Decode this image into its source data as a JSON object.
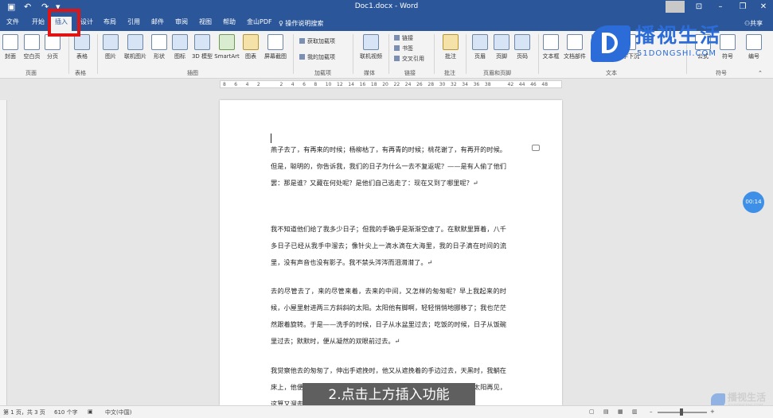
{
  "titlebar": {
    "doc_title": "Doc1.docx  -  Word",
    "save_icon": "save-icon",
    "undo_icon": "undo-icon",
    "redo_icon": "redo-icon"
  },
  "tabs": [
    {
      "label": "文件",
      "active": false
    },
    {
      "label": "开始",
      "active": false
    },
    {
      "label": "插入",
      "active": true
    },
    {
      "label": "设计",
      "active": false
    },
    {
      "label": "布局",
      "active": false
    },
    {
      "label": "引用",
      "active": false
    },
    {
      "label": "邮件",
      "active": false
    },
    {
      "label": "审阅",
      "active": false
    },
    {
      "label": "视图",
      "active": false
    },
    {
      "label": "帮助",
      "active": false
    },
    {
      "label": "金山PDF",
      "active": false
    }
  ],
  "tell_me": "操作说明搜索",
  "share": "共享",
  "ribbon": {
    "buttons": [
      "封面",
      "空白页",
      "分页",
      "表格",
      "图片",
      "联机图片",
      "形状",
      "图标",
      "3D 模型",
      "SmartArt",
      "图表",
      "屏幕截图",
      "联机视频",
      "批注",
      "页眉",
      "页脚",
      "页码",
      "文本框",
      "文档部件",
      "艺术字",
      "首字下沉",
      "公式",
      "符号",
      "编号"
    ],
    "small": [
      "获取加载项",
      "我的加载项",
      "链接",
      "书签",
      "交叉引用"
    ],
    "groups": [
      "页面",
      "表格",
      "插图",
      "加载项",
      "媒体",
      "链接",
      "批注",
      "页眉和页脚",
      "文本",
      "符号"
    ]
  },
  "logo": {
    "name": "播视生活",
    "url": "51DONGSHI.COM"
  },
  "ruler_ticks": [
    "8",
    "6",
    "4",
    "2",
    "",
    "2",
    "4",
    "6",
    "8",
    "10",
    "12",
    "14",
    "16",
    "18",
    "20",
    "22",
    "24",
    "26",
    "28",
    "30",
    "32",
    "34",
    "36",
    "38",
    "",
    "42",
    "44",
    "46",
    "48"
  ],
  "document": {
    "paragraphs": [
      "燕子去了，有再来的时候；杨柳枯了，有再青的时候；桃花谢了，有再开的时候。但是，聪明的，你告诉我，我们的日子为什么一去不复返呢？——是有人偷了他们罢：那是谁？又藏在何处呢？是他们自己逃走了：现在又到了哪里呢？↵",
      "我不知道他们给了我多少日子；但我的手确乎是渐渐空虚了。在默默里算着，八千多日子已经从我手中溜去；像针尖上一滴水滴在大海里，我的日子滴在时间的流里，没有声音也没有影子。我不禁头涔涔而泪潸潸了。↵",
      "去的尽管去了，来的尽管来着，去来的中间，又怎样的匆匆呢？早上我起来的时候，小屋里射进两三方斜斜的太阳。太阳他有脚啊，轻轻悄悄地挪移了；我也茫茫然跟着旋转。于是——洗手的时候，日子从水盆里过去；吃饭的时候，日子从饭碗里过去；默默时，便从凝然的双眼前过去。↵",
      "我觉察他去的匆匆了，伸出手遮挽时，他又从遮挽着的手边过去，天黑时，我躺在床上，他便伶伶俐俐地从我身上跨过，从我脚边飞去了。等我睁开眼和太阳再见，这算又溜走了一日。我掩着面叹息。但是新来的日子的影儿又开始在"
    ]
  },
  "timer": "00:14",
  "caption": "2.点击上方插入功能",
  "watermark2": {
    "name": "播视生活",
    "url": "51DONGSHI.COM"
  },
  "status": {
    "page": "第 1 页，共 3 页",
    "words": "610 个字",
    "lang": "中文(中国)"
  },
  "colors": {
    "brand": "#2b579a",
    "annotation": "#e01414",
    "logo": "#2b6cd8"
  }
}
